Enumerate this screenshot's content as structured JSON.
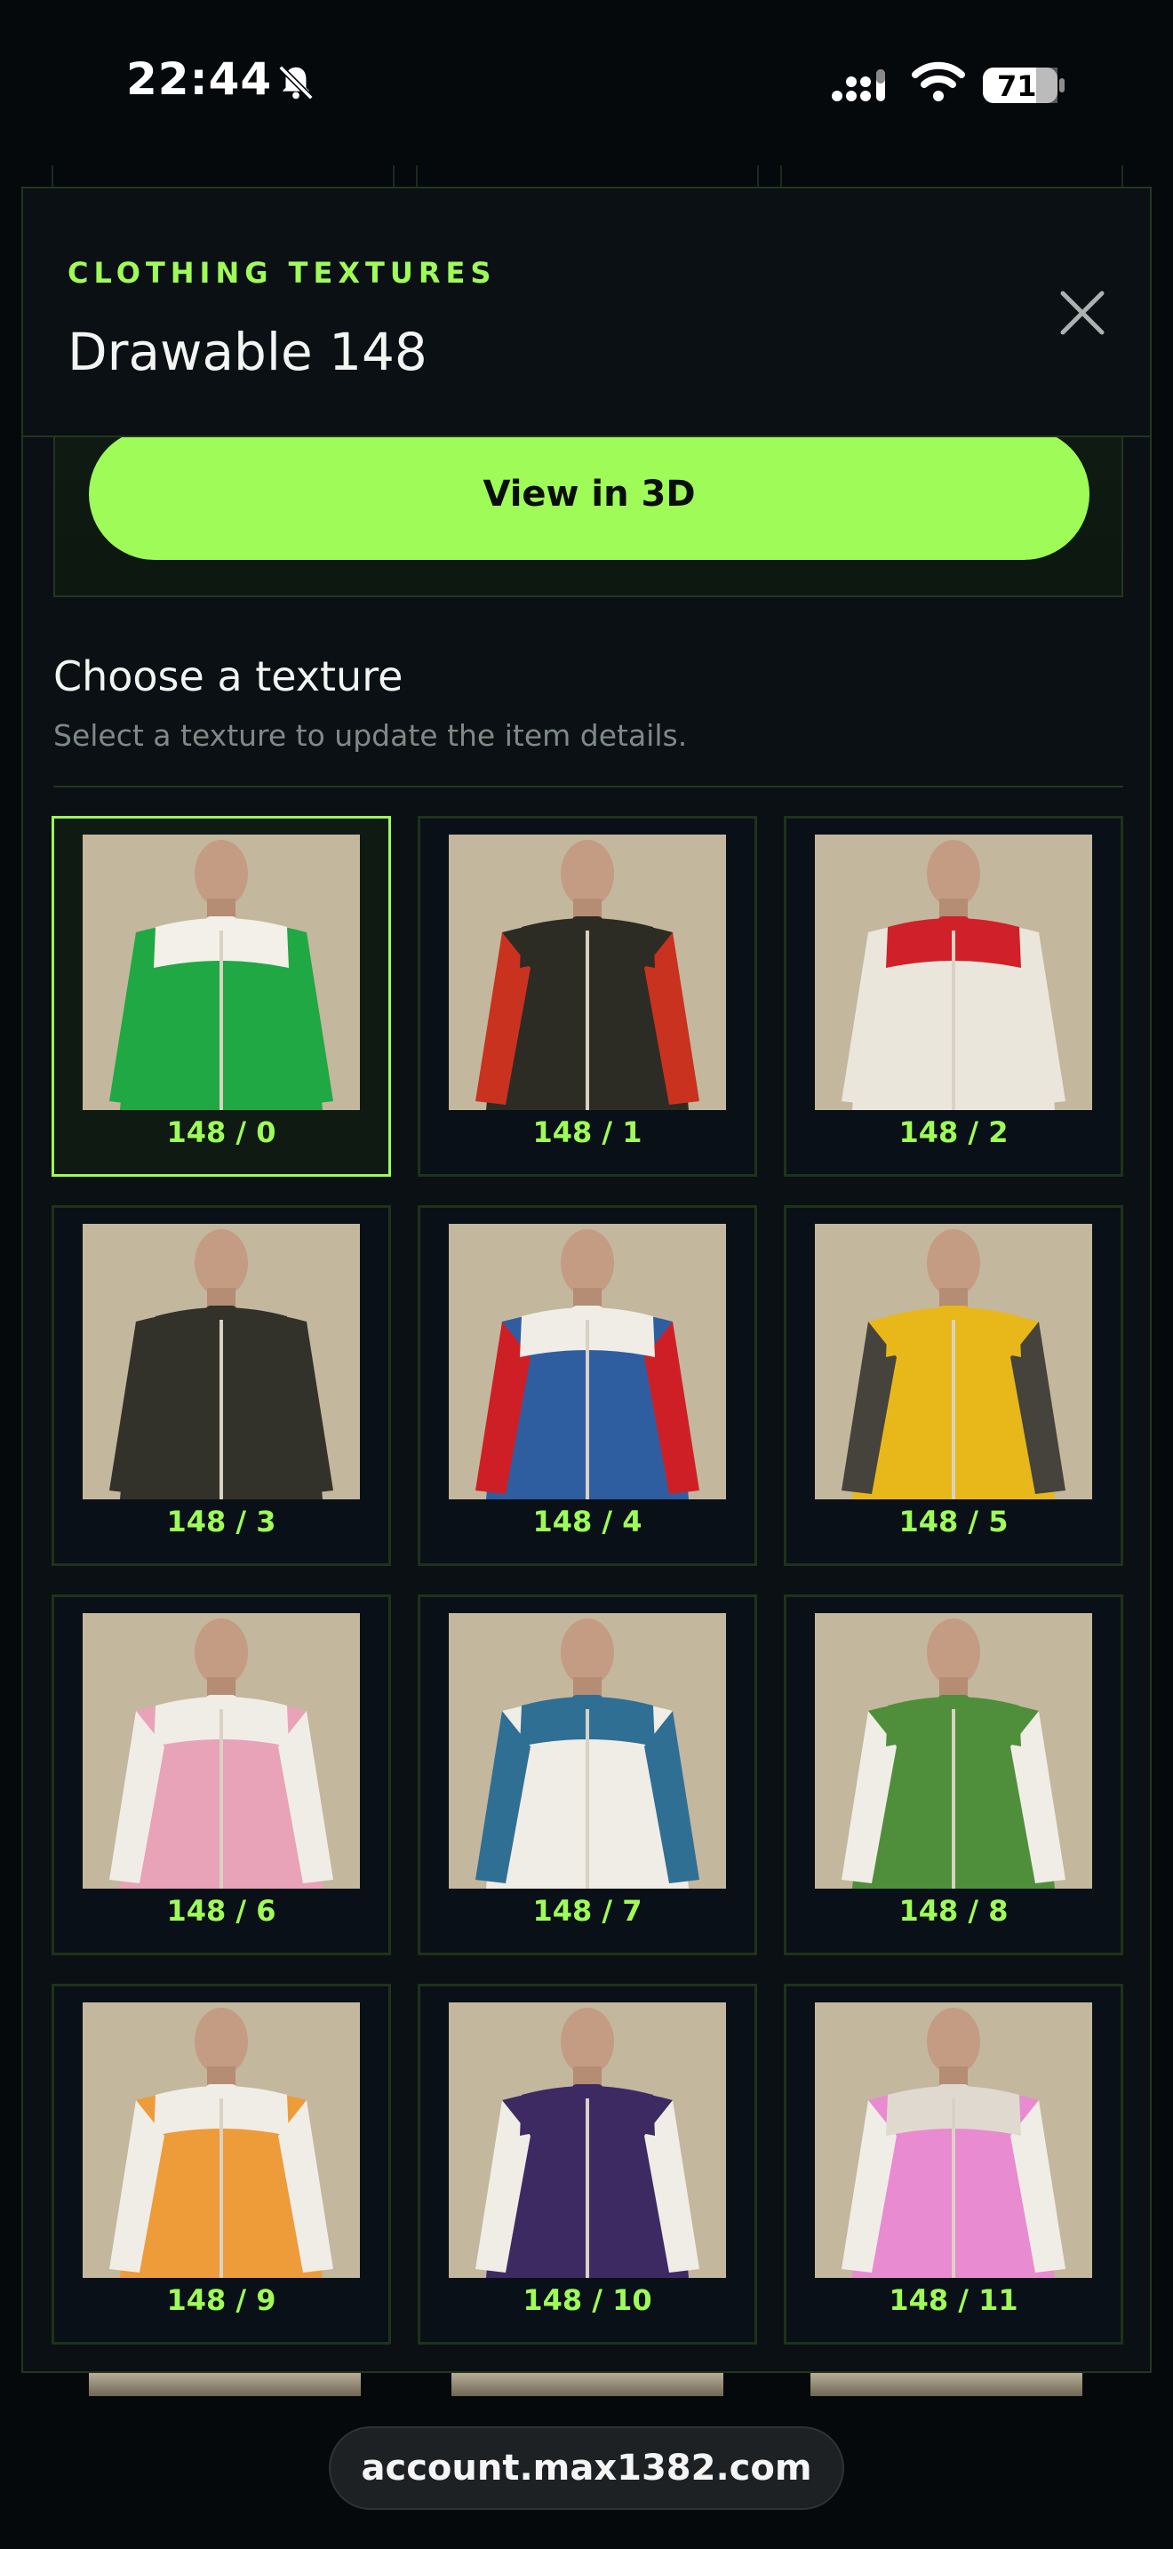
{
  "status_bar": {
    "time": "22:44",
    "battery": "71",
    "icons": [
      "bell-slash-icon",
      "signal-icon",
      "wifi-icon",
      "battery-icon"
    ]
  },
  "modal": {
    "kicker": "CLOTHING TEXTURES",
    "title": "Drawable 148",
    "close_icon": "close-icon",
    "cta_label": "View in 3D",
    "section_title": "Choose a texture",
    "section_subtitle": "Select a texture to update the item details."
  },
  "textures": [
    {
      "label": "148 / 0",
      "body": "#1fa843",
      "sleeve": "#1fa843",
      "band": "#f2f0e8",
      "selected": true
    },
    {
      "label": "148 / 1",
      "body": "#2d2c24",
      "sleeve": "#c8321e",
      "band": "#2d2c24",
      "selected": false
    },
    {
      "label": "148 / 2",
      "body": "#ebe6dc",
      "sleeve": "#ebe6dc",
      "band": "#d0202a",
      "selected": false
    },
    {
      "label": "148 / 3",
      "body": "#33322a",
      "sleeve": "#33322a",
      "band": "#33322a",
      "selected": false
    },
    {
      "label": "148 / 4",
      "body": "#2f5ea0",
      "sleeve": "#cf1f26",
      "band": "#f0ede6",
      "selected": false
    },
    {
      "label": "148 / 5",
      "body": "#e8b81a",
      "sleeve": "#45433b",
      "band": "#e8b81a",
      "selected": false
    },
    {
      "label": "148 / 6",
      "body": "#e9a3b9",
      "sleeve": "#f0ede6",
      "band": "#f0ede6",
      "selected": false
    },
    {
      "label": "148 / 7",
      "body": "#f0ede6",
      "sleeve": "#2f6f94",
      "band": "#2f6f94",
      "selected": false
    },
    {
      "label": "148 / 8",
      "body": "#4f8f3b",
      "sleeve": "#f0ede6",
      "band": "#4f8f3b",
      "selected": false
    },
    {
      "label": "148 / 9",
      "body": "#ee9b3a",
      "sleeve": "#f0ede6",
      "band": "#f0ede6",
      "selected": false
    },
    {
      "label": "148 / 10",
      "body": "#3d2a63",
      "sleeve": "#f0ede6",
      "band": "#3d2a63",
      "selected": false
    },
    {
      "label": "148 / 11",
      "body": "#e98bd0",
      "sleeve": "#f0ede6",
      "band": "#e0d9cf",
      "selected": false
    }
  ],
  "browser": {
    "url": "account.max1382.com"
  }
}
